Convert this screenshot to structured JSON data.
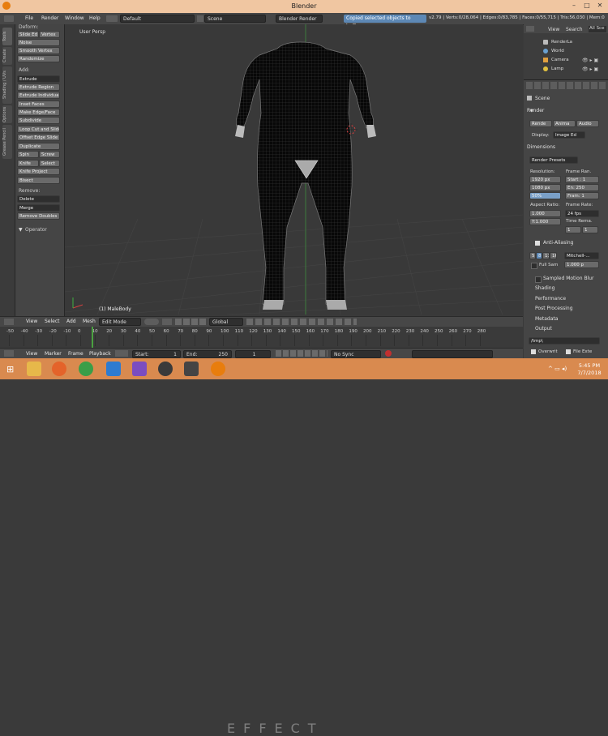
{
  "window": {
    "title": "Blender"
  },
  "menubar": {
    "file": "File",
    "render": "Render",
    "window": "Window",
    "help": "Help",
    "layout": "Default",
    "scene": "Scene",
    "engine": "Blender Render",
    "message": "Copied selected objects to buffer",
    "stats": "v2.79 | Verts:0/28,064 | Edges:0/83,785 | Faces:0/55,715 | Tris:56,030 | Mem:0"
  },
  "tool_tabs": [
    "Tools",
    "Create",
    "Shading / UVs",
    "Options",
    "Grease Pencil"
  ],
  "toolshelf": {
    "deform_header": "Deform:",
    "deform": [
      "Slide Ed",
      "Vertex",
      "Noise",
      "Smooth Vertex",
      "Randomize"
    ],
    "add_header": "Add:",
    "extrude": "Extrude",
    "add": [
      "Extrude Region",
      "Extrude Individual",
      "Inset Faces",
      "Make Edge/Face",
      "Subdivide",
      "Loop Cut and Slide",
      "Offset Edge Slide",
      "Duplicate"
    ],
    "spin": "Spin",
    "screw": "Screw",
    "knife": "Knife",
    "select": "Select",
    "knife_project": "Knife Project",
    "bisect": "Bisect",
    "remove_header": "Remove:",
    "delete": "Delete",
    "merge": "Merge",
    "remove_doubles": "Remove Doubles",
    "operator": "Operator"
  },
  "viewport": {
    "label": "User Persp",
    "object": "(1) MaleBody"
  },
  "outliner": {
    "view": "View",
    "search": "Search",
    "all_scenes": "All Sce",
    "items": [
      "RenderLa",
      "World",
      "Camera",
      "Lamp"
    ]
  },
  "properties": {
    "scene": "Scene",
    "render": "Render",
    "render_btn": "Rende",
    "anim_btn": "Anima",
    "audio_btn": "Audio",
    "display_label": "Display:",
    "display_value": "Image Ed",
    "dimensions": "Dimensions",
    "presets": "Render Presets",
    "resolution": "Resolution:",
    "res_x": "1920 px",
    "res_y": "1080 px",
    "res_pct": "50%",
    "frame_range": "Frame Ran.",
    "start": "Start : 1",
    "end": "En: 250",
    "step": "Fram: 1",
    "aspect": "Aspect Ratio:",
    "aspect_x": "1.000",
    "aspect_y": "Y:1.000",
    "frame_rate": "Frame Rate:",
    "fps": "24 fps",
    "time_remap": "Time Rema.",
    "remap_old": "1",
    "remap_new": "1",
    "anti_aliasing": "Anti-Aliasing",
    "aa": [
      "5",
      "8",
      "11",
      "16"
    ],
    "filter": "Mitchell-...",
    "full_sample": "Full Sam",
    "filter_size": "1.000 p",
    "sampled_motion_blur": "Sampled Motion Blur",
    "sections": [
      "Shading",
      "Performance",
      "Post Processing",
      "Metadata",
      "Output"
    ],
    "output_path": "/tmp\\",
    "overwrite": "Overwrit",
    "file_ext": "File Exte"
  },
  "view3d_header": {
    "view": "View",
    "select": "Select",
    "add": "Add",
    "mesh": "Mesh",
    "mode": "Edit Mode",
    "orientation": "Global"
  },
  "timeline": {
    "ticks": [
      "-50",
      "-40",
      "-30",
      "-20",
      "-10",
      "0",
      "10",
      "20",
      "30",
      "40",
      "50",
      "60",
      "70",
      "80",
      "90",
      "100",
      "110",
      "120",
      "130",
      "140",
      "150",
      "160",
      "170",
      "180",
      "190",
      "200",
      "210",
      "220",
      "230",
      "240",
      "250",
      "260",
      "270",
      "280"
    ]
  },
  "timeline_header": {
    "view": "View",
    "marker": "Marker",
    "frame": "Frame",
    "playback": "Playback",
    "start": "Start:",
    "start_val": "1",
    "end": "End:",
    "end_val": "250",
    "current": "1",
    "sync": "No Sync"
  },
  "taskbar": {
    "time": "5:45 PM",
    "date": "7/7/2018",
    "watermark": "EFFECT"
  },
  "colors": {
    "accent": "#5d88b5",
    "titlebar": "#f0c6a1",
    "taskbar": "#d98a4f",
    "grid": "#474747"
  }
}
